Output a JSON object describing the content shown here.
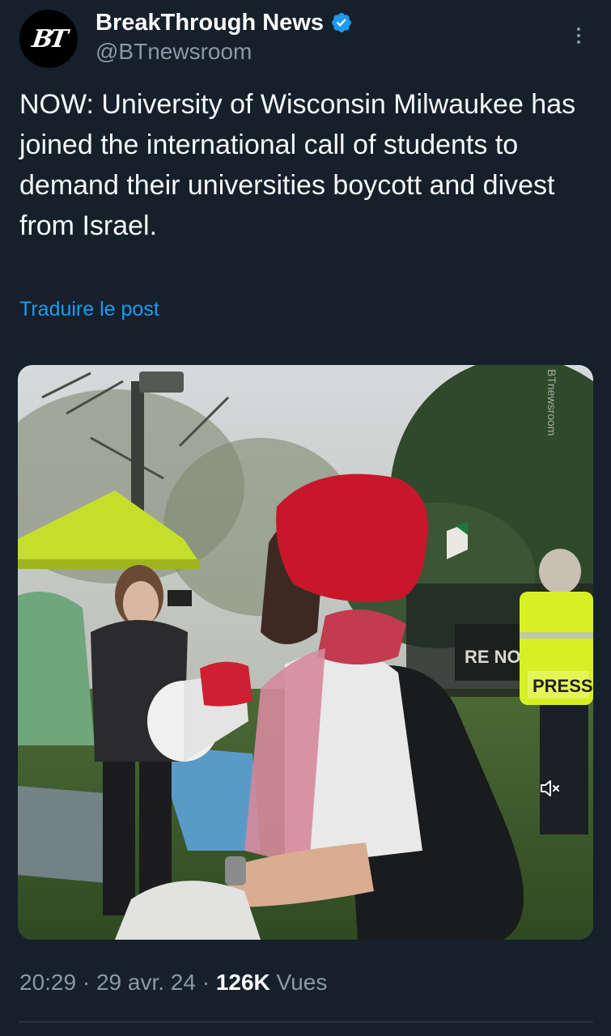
{
  "author": {
    "display_name": "BreakThrough News",
    "handle": "@BTnewsroom",
    "avatar_text": "BT",
    "verified": true
  },
  "tweet": {
    "text": "NOW: University of Wisconsin Milwaukee has joined the international call of students to demand their universities boycott and divest from Israel.",
    "translate_label": "Traduire le post"
  },
  "media": {
    "type": "video",
    "muted": true,
    "sign_texts": [
      "RE NO",
      "PRESS"
    ],
    "watermark": "BTnewsroom"
  },
  "meta": {
    "time": "20:29",
    "separator_1": " · ",
    "date": "29 avr. 24",
    "separator_2": " · ",
    "views_count": "126K",
    "views_label": " Vues"
  },
  "colors": {
    "background": "#15202b",
    "text_primary": "#f7f9f9",
    "text_secondary": "#8b98a5",
    "accent": "#1d9bf0"
  },
  "icons": {
    "verified": "verified-badge-icon",
    "more": "more-options-icon",
    "mute": "speaker-muted-icon"
  }
}
